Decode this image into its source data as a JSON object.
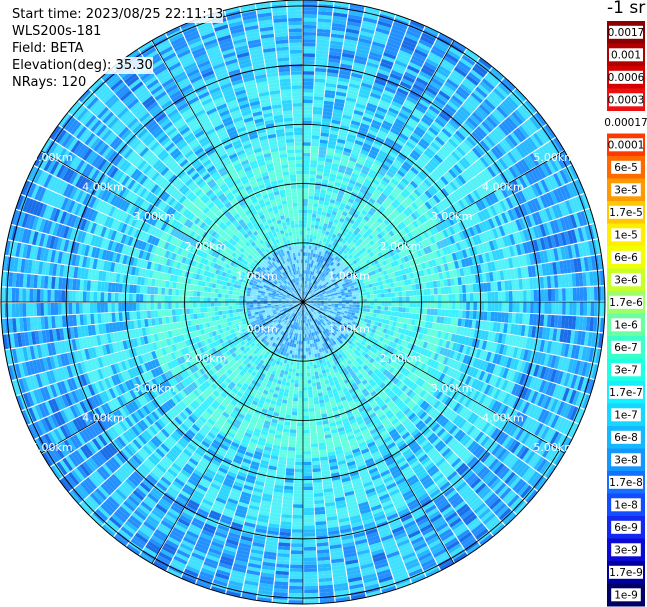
{
  "info": {
    "start_time": "Start time: 2023/08/25 22:11:13",
    "instrument": "WLS200s-181",
    "field": "Field: BETA",
    "elevation": "Elevation(deg): 35.30",
    "nrays": "NRays: 120"
  },
  "chart_data": {
    "type": "heatmap",
    "projection": "polar (PPI scan)",
    "range_rings_km": [
      1.0,
      2.0,
      3.0,
      4.0,
      5.0
    ],
    "ring_labels": [
      "1.00km",
      "2.00km",
      "3.00km",
      "4.00km",
      "5.00km"
    ],
    "max_range_km": 5.1,
    "n_rays": 120,
    "colorbar": {
      "title": "-1 sr",
      "levels": [
        {
          "label": "0.0017",
          "color": "#8b0000"
        },
        {
          "label": "0.001",
          "color": "#b00000"
        },
        {
          "label": "0.0006",
          "color": "#d40000"
        },
        {
          "label": "0.0003",
          "color": "#ee1010"
        },
        {
          "label": "0.00017",
          "color": "#ffffff"
        },
        {
          "label": "0.0001",
          "color": "#ff3a00"
        },
        {
          "label": "6e-5",
          "color": "#ff6a00"
        },
        {
          "label": "3e-5",
          "color": "#ff9900"
        },
        {
          "label": "1.7e-5",
          "color": "#ffc800"
        },
        {
          "label": "1e-5",
          "color": "#ffee00"
        },
        {
          "label": "6e-6",
          "color": "#f2ff00"
        },
        {
          "label": "3e-6",
          "color": "#c8ff2a"
        },
        {
          "label": "1.7e-6",
          "color": "#9cff6a"
        },
        {
          "label": "1e-6",
          "color": "#6affa0"
        },
        {
          "label": "6e-7",
          "color": "#3cffc8"
        },
        {
          "label": "3e-7",
          "color": "#1effe4"
        },
        {
          "label": "1.7e-7",
          "color": "#14f0ff"
        },
        {
          "label": "1e-7",
          "color": "#14d8ff"
        },
        {
          "label": "6e-8",
          "color": "#14b8ff"
        },
        {
          "label": "3e-8",
          "color": "#1496ff"
        },
        {
          "label": "1.7e-8",
          "color": "#1470ff"
        },
        {
          "label": "1e-8",
          "color": "#144cff"
        },
        {
          "label": "6e-9",
          "color": "#1428f0"
        },
        {
          "label": "3e-9",
          "color": "#0a0ad2"
        },
        {
          "label": "1.7e-9",
          "color": "#0000a0"
        },
        {
          "label": "1e-9",
          "color": "#000064"
        }
      ]
    }
  }
}
